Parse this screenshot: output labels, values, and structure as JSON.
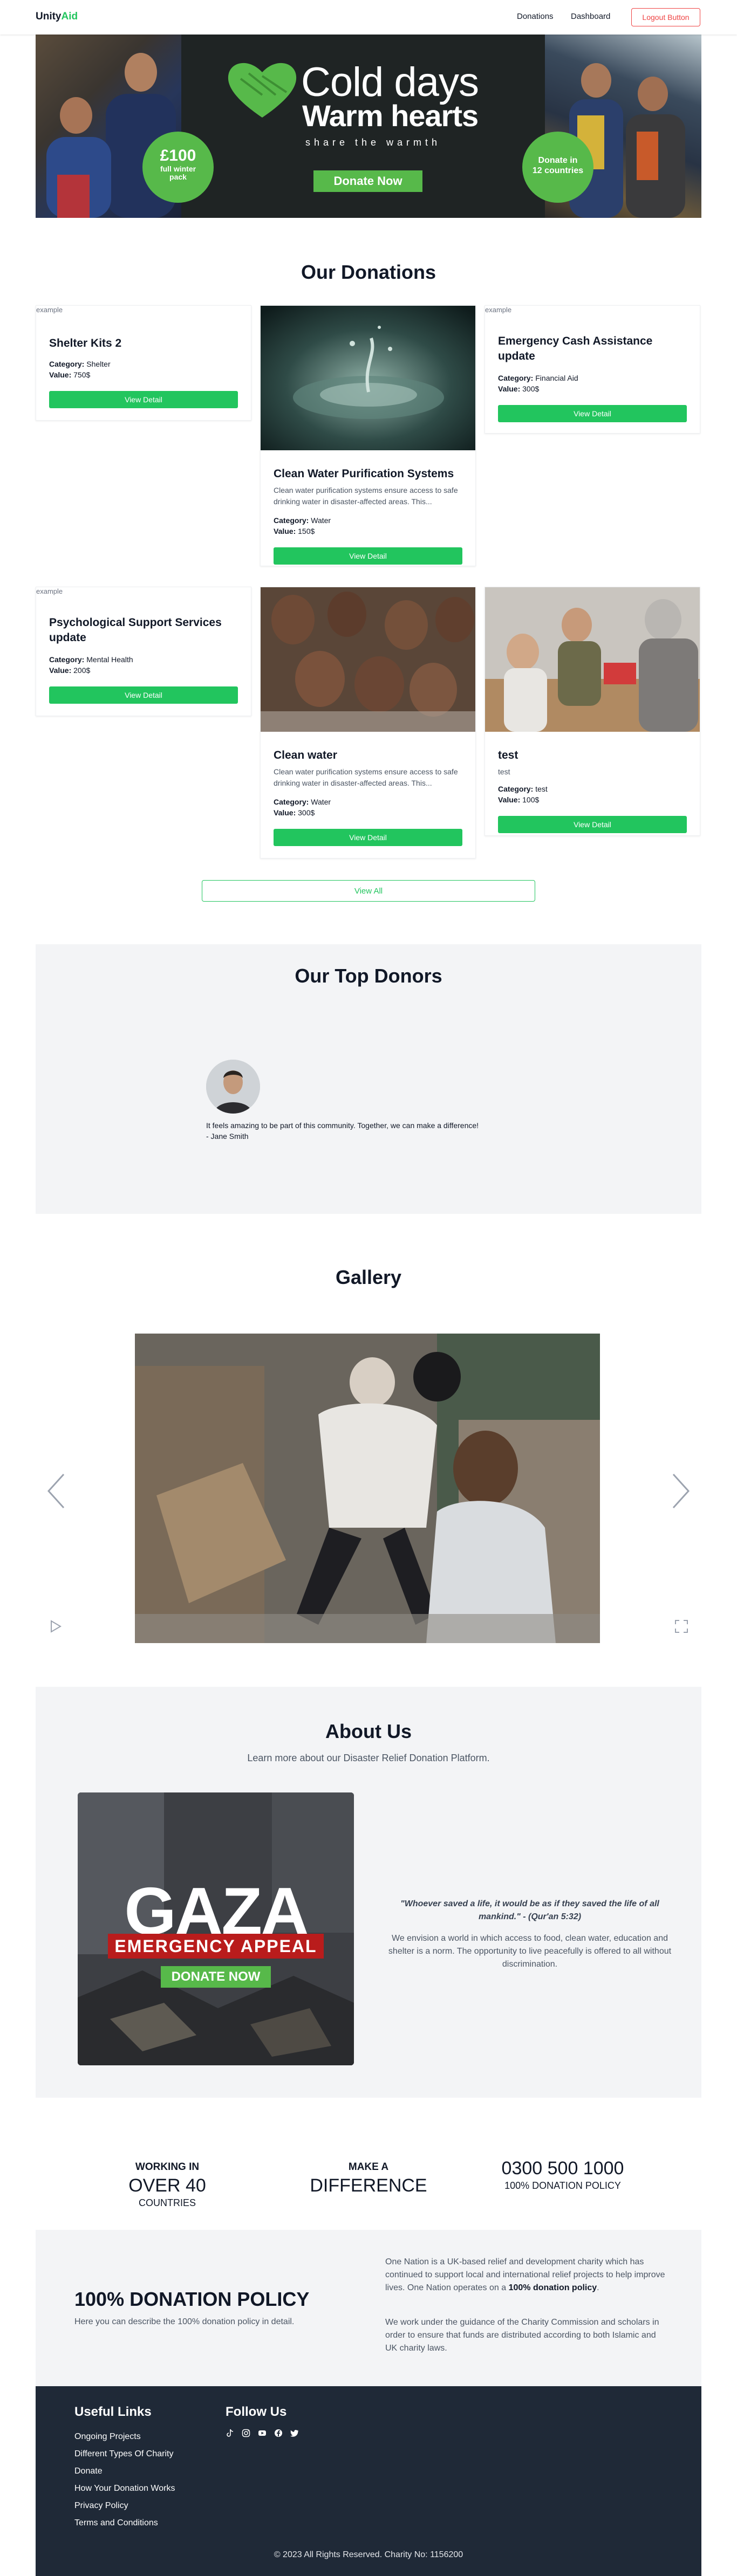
{
  "nav": {
    "brand_prefix": "Unity",
    "brand_suffix": "Aid",
    "links": [
      "Donations",
      "Dashboard"
    ],
    "logout_label": "Logout Button"
  },
  "hero": {
    "title1": "Cold days",
    "title2": "Warm hearts",
    "tagline": "share the warmth",
    "donate_label": "Donate Now",
    "badge_left_big": "£100",
    "badge_left_small1": "full winter",
    "badge_left_small2": "pack",
    "badge_right_1": "Donate in",
    "badge_right_2": "12 countries"
  },
  "donations": {
    "title": "Our Donations",
    "broken_alt": "example",
    "view_detail_label": "View Detail",
    "category_label": "Category:",
    "value_label": "Value:",
    "cards": [
      {
        "title": "Shelter Kits 2",
        "desc": "",
        "category": "Shelter",
        "value": "750$"
      },
      {
        "title": "Clean Water Purification Systems",
        "desc": "Clean water purification systems ensure access to safe drinking water in disaster-affected areas. This...",
        "category": "Water",
        "value": "150$"
      },
      {
        "title": "Emergency Cash Assistance update",
        "desc": "",
        "category": "Financial Aid",
        "value": "300$"
      },
      {
        "title": "Psychological Support Services update",
        "desc": "",
        "category": "Mental Health",
        "value": "200$"
      },
      {
        "title": "Clean water",
        "desc": "Clean water purification systems ensure access to safe drinking water in disaster-affected areas. This...",
        "category": "Water",
        "value": "300$"
      },
      {
        "title": "test",
        "desc": "test",
        "category": "test",
        "value": "100$"
      }
    ],
    "view_all_label": "View All"
  },
  "donors": {
    "title": "Our Top Donors",
    "quote": "It feels amazing to be part of this community. Together, we can make a difference!",
    "name": "- Jane Smith"
  },
  "gallery": {
    "title": "Gallery"
  },
  "about": {
    "title": "About Us",
    "subtitle": "Learn more about our Disaster Relief Donation Platform.",
    "gaza_word": "GAZA",
    "gaza_appeal": "EMERGENCY APPEAL",
    "gaza_donate": "DONATE NOW",
    "quote": "\"Whoever saved a life, it would be as if they saved the life of all mankind.\" - (Qur'an 5:32)",
    "body": "We envision a world in which access to food, clean water, education and shelter is a norm. The opportunity to live peacefully is offered to all without discrimination."
  },
  "stats": [
    {
      "small": "WORKING IN",
      "big": "OVER 40",
      "sub": "COUNTRIES"
    },
    {
      "small": "MAKE A",
      "big": "DIFFERENCE",
      "sub": ""
    },
    {
      "small": "",
      "big": "0300 500 1000",
      "sub": "100% DONATION POLICY"
    }
  ],
  "policy": {
    "title": "100% DONATION POLICY",
    "desc": "Here you can describe the 100% donation policy in detail.",
    "p1_before": "One Nation is a UK-based relief and development charity which has continued to support local and international relief projects to help improve lives. One Nation operates on a ",
    "p1_bold": "100% donation policy",
    "p1_after": ".",
    "p2": "We work under the guidance of the Charity Commission and scholars in order to ensure that funds are distributed according to both Islamic and UK charity laws."
  },
  "footer": {
    "useful_links_title": "Useful Links",
    "links": [
      "Ongoing Projects",
      "Different Types Of Charity",
      "Donate",
      "How Your Donation Works",
      "Privacy Policy",
      "Terms and Conditions"
    ],
    "follow_title": "Follow Us",
    "social_icons": [
      "tiktok-icon",
      "instagram-icon",
      "youtube-icon",
      "facebook-icon",
      "twitter-icon"
    ],
    "copyright": "© 2023 All Rights Reserved. Charity No: 1156200"
  },
  "colors": {
    "accent_green": "#22c55e",
    "logout_red": "#ef4444",
    "footer_bg": "#1f2937",
    "section_bg": "#f3f4f6"
  }
}
